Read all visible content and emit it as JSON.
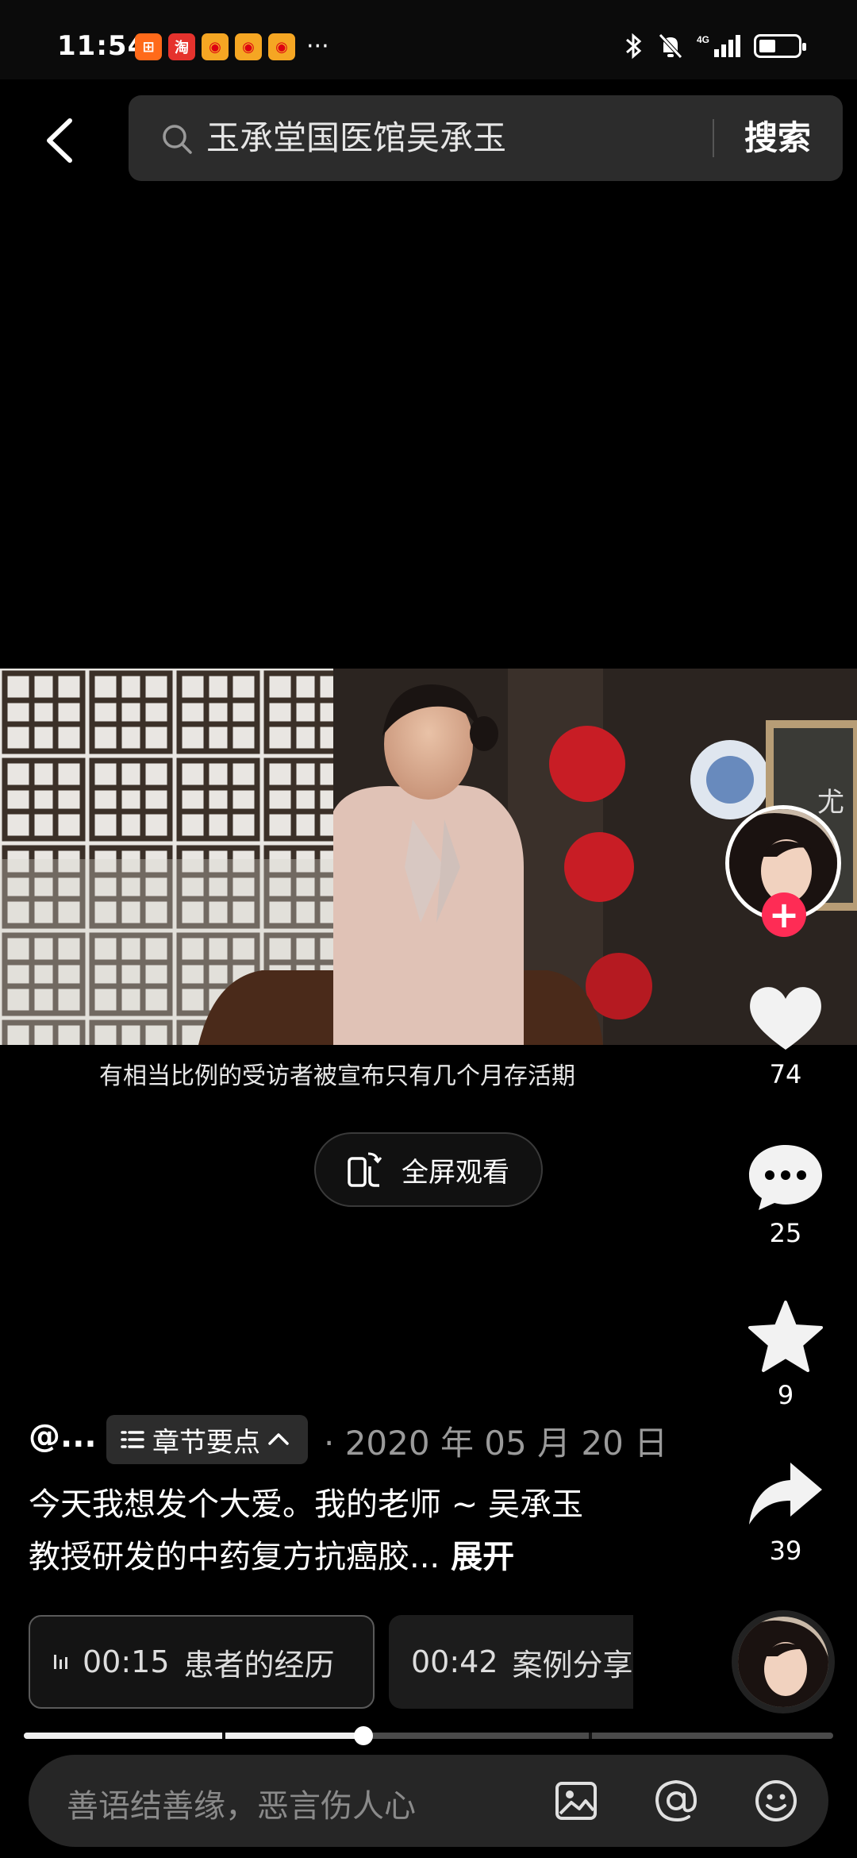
{
  "status_bar": {
    "time": "11:54",
    "notifications": [
      "app-notification-orange",
      "taobao-notification",
      "weibo-notification",
      "weibo-notification",
      "weibo-notification"
    ],
    "more": "···",
    "network": "4G"
  },
  "search": {
    "query": "玉承堂国医馆吴承玉",
    "button_label": "搜索"
  },
  "video": {
    "subtitle": "有相当比例的受访者被宣布只有几个月存活期",
    "fullscreen_label": "全屏观看"
  },
  "rail": {
    "likes": "74",
    "comments": "25",
    "favorites": "9",
    "shares": "39"
  },
  "post": {
    "author": "@...",
    "chapter_chip_label": "章节要点",
    "date": "· 2020 年 05 月 20 日",
    "caption_line1": "今天我想发个大爱。我的老师 ~ 吴承玉",
    "caption_line2": "教授研发的中药复方抗癌胶...",
    "expand_label": "展开"
  },
  "chapters": [
    {
      "time": "00:15",
      "title": "患者的经历"
    },
    {
      "time": "00:42",
      "title": "案例分享"
    }
  ],
  "progress": {
    "played_fraction": 0.42
  },
  "comment_bar": {
    "placeholder": "善语结善缘，恶言伤人心"
  },
  "colors": {
    "accent": "#fe2c55",
    "background": "#000000",
    "surface": "#2c2c2c"
  }
}
